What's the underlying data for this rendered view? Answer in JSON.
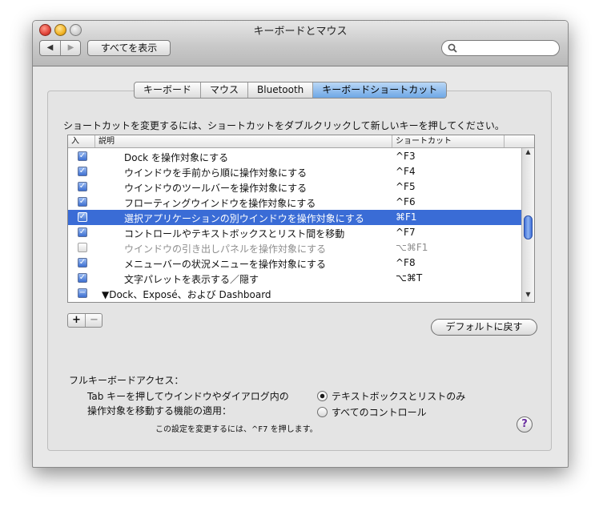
{
  "window": {
    "title": "キーボードとマウス"
  },
  "toolbar": {
    "back_glyph": "◀",
    "forward_glyph": "▶",
    "show_all_label": "すべてを表示",
    "search_value": ""
  },
  "tabs": [
    {
      "label": "キーボード"
    },
    {
      "label": "マウス"
    },
    {
      "label": "Bluetooth"
    },
    {
      "label": "キーボードショートカット",
      "active": true
    }
  ],
  "instruction": "ショートカットを変更するには、ショートカットをダブルクリックして新しいキーを押してください。",
  "table": {
    "headers": {
      "on": "入",
      "description": "説明",
      "shortcut": "ショートカット"
    },
    "rows": [
      {
        "checked": true,
        "description": "Dock を操作対象にする",
        "shortcut": "^F3"
      },
      {
        "checked": true,
        "description": "ウインドウを手前から順に操作対象にする",
        "shortcut": "^F4"
      },
      {
        "checked": true,
        "description": "ウインドウのツールバーを操作対象にする",
        "shortcut": "^F5"
      },
      {
        "checked": true,
        "description": "フローティングウインドウを操作対象にする",
        "shortcut": "^F6"
      },
      {
        "checked": true,
        "description": "選択アプリケーションの別ウインドウを操作対象にする",
        "shortcut": "⌘F1",
        "selected": true
      },
      {
        "checked": true,
        "description": "コントロールやテキストボックスとリスト間を移動",
        "shortcut": "^F7"
      },
      {
        "checked": false,
        "description": "ウインドウの引き出しパネルを操作対象にする",
        "shortcut": "⌥⌘F1",
        "dimmed": true
      },
      {
        "checked": true,
        "description": "メニューバーの状況メニューを操作対象にする",
        "shortcut": "^F8"
      },
      {
        "checked": true,
        "description": "文字パレットを表示する／隠す",
        "shortcut": "⌥⌘T"
      },
      {
        "checked": "mixed",
        "description": "▼Dock、Exposé、および Dashboard",
        "shortcut": "",
        "group": true
      }
    ]
  },
  "list_controls": {
    "add": "+",
    "remove": "−"
  },
  "restore_defaults_label": "デフォルトに戻す",
  "full_keyboard_access": {
    "title": "フルキーボードアクセス：",
    "description_line1": "Tab キーを押してウインドウやダイアログ内の",
    "description_line2": "操作対象を移動する機能の適用：",
    "options": [
      {
        "label": "テキストボックスとリストのみ",
        "selected": true
      },
      {
        "label": "すべてのコントロール",
        "selected": false
      }
    ],
    "note": "この設定を変更するには、^F7 を押します。"
  },
  "help_label": "?",
  "colors": {
    "selection": "#3a6cd6",
    "active_tab": "#6ea7e6",
    "window_bg": "#e8e8e8"
  }
}
